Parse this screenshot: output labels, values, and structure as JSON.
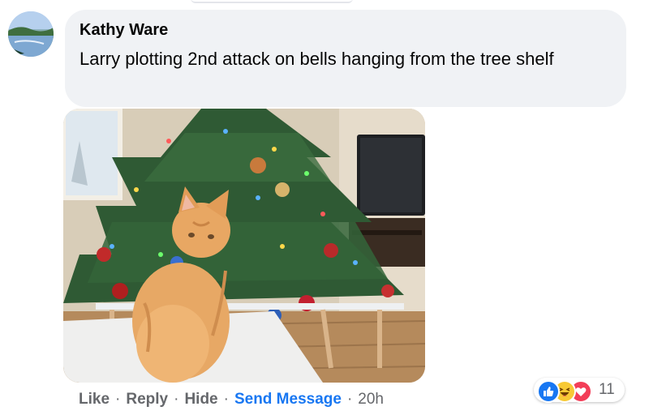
{
  "comment": {
    "author": "Kathy Ware",
    "text": "Larry plotting 2nd attack on bells hanging from the tree shelf",
    "avatar_icon": "avatar-photo"
  },
  "attachment": {
    "icon": "photo-cat-christmas-tree"
  },
  "actions": {
    "like": "Like",
    "reply": "Reply",
    "hide": "Hide",
    "send_message": "Send Message",
    "separator": "·",
    "timestamp": "20h"
  },
  "reactions": {
    "icons": [
      "like-icon",
      "haha-icon",
      "love-icon"
    ],
    "count": "11"
  },
  "colors": {
    "bubble": "#f0f2f5",
    "link": "#1877f2",
    "muted": "#65676b",
    "like": "#1877f2",
    "haha": "#f7c935",
    "love": "#f33e58"
  }
}
